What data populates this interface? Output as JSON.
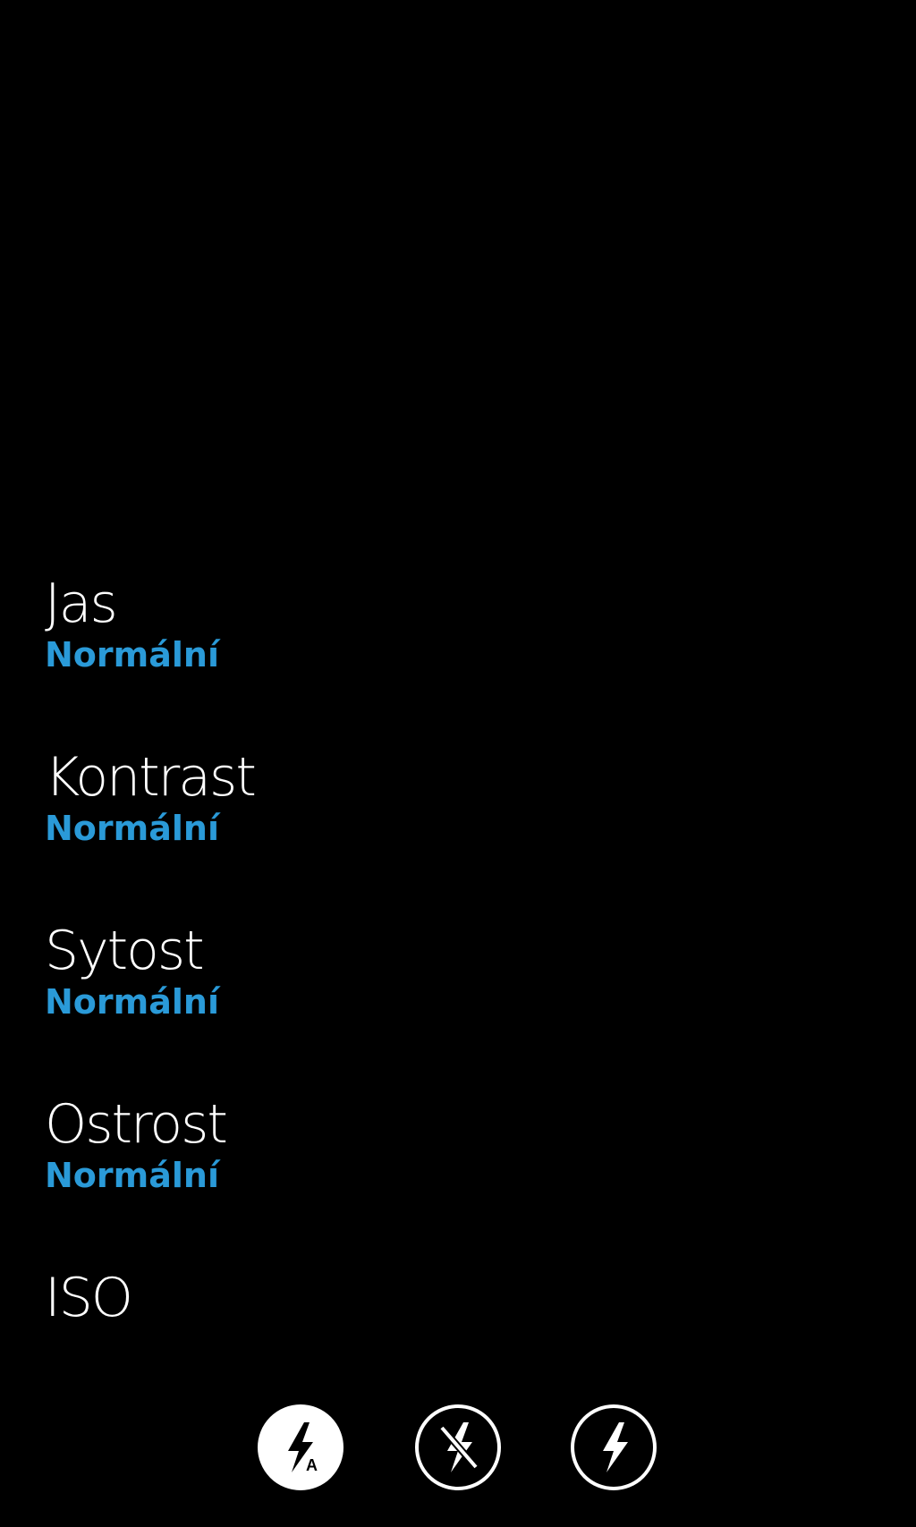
{
  "settings": [
    {
      "id": "brightness",
      "label": "Jas",
      "value": "Normální"
    },
    {
      "id": "contrast",
      "label": "Kontrast",
      "value": "Normální"
    },
    {
      "id": "saturation",
      "label": "Sytost",
      "value": "Normální"
    },
    {
      "id": "sharpness",
      "label": "Ostrost",
      "value": "Normální"
    },
    {
      "id": "iso",
      "label": "ISO"
    }
  ],
  "flash_modes": [
    {
      "id": "auto",
      "icon": "flash-auto-icon",
      "selected": true
    },
    {
      "id": "off",
      "icon": "flash-off-icon",
      "selected": false
    },
    {
      "id": "on",
      "icon": "flash-on-icon",
      "selected": false
    }
  ],
  "colors": {
    "background": "#000000",
    "label": "#ffffff",
    "accent": "#2a9ad8"
  }
}
